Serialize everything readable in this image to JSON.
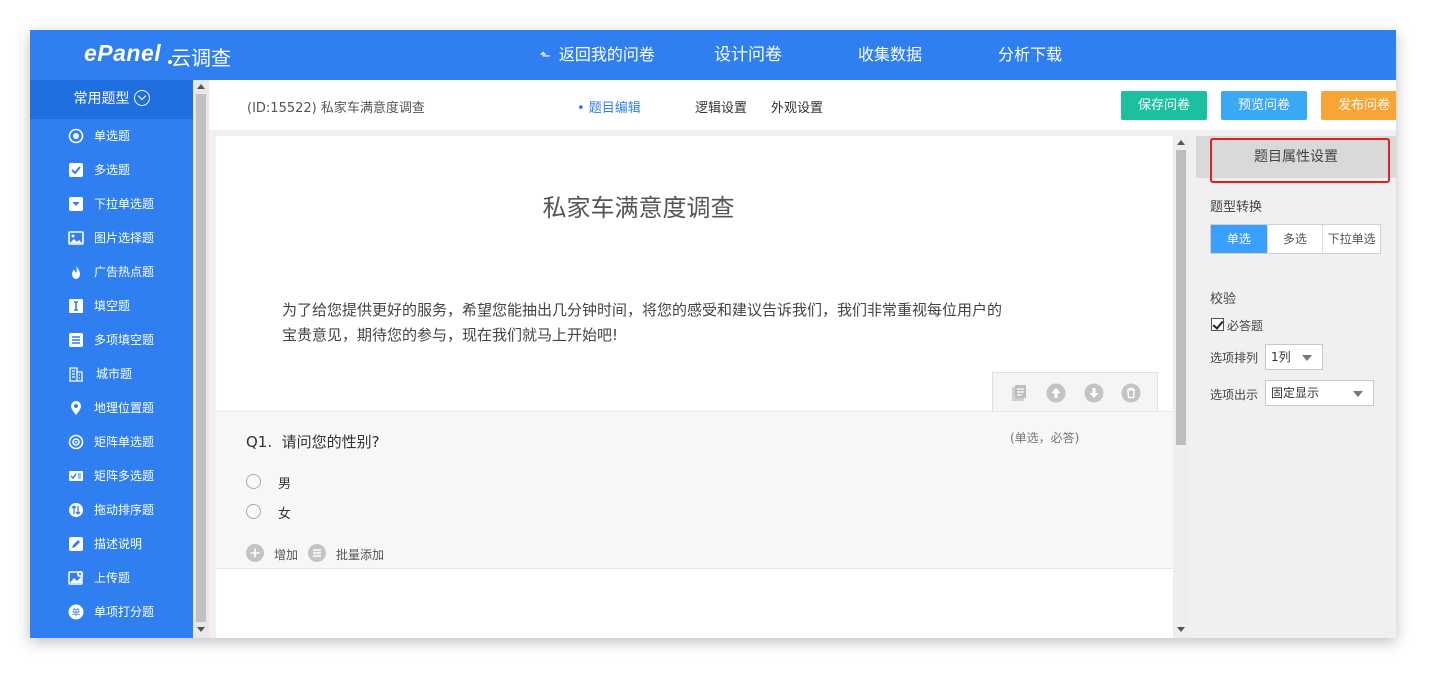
{
  "header": {
    "logo_main": "ePanel",
    "logo_sub": "云调查",
    "nav": [
      {
        "label": "返回我的问卷"
      },
      {
        "label": "设计问卷"
      },
      {
        "label": "收集数据"
      },
      {
        "label": "分析下载"
      }
    ]
  },
  "sidebar": {
    "title": "常用题型",
    "items": [
      {
        "label": "单选题",
        "icon": "radio-icon"
      },
      {
        "label": "多选题",
        "icon": "checkbox-icon"
      },
      {
        "label": "下拉单选题",
        "icon": "dropdown-icon"
      },
      {
        "label": "图片选择题",
        "icon": "image-icon"
      },
      {
        "label": "广告热点题",
        "icon": "flame-icon"
      },
      {
        "label": "填空题",
        "icon": "text-cursor-icon"
      },
      {
        "label": "多项填空题",
        "icon": "list-icon"
      },
      {
        "label": "城市题",
        "icon": "building-icon"
      },
      {
        "label": "地理位置题",
        "icon": "location-pin-icon"
      },
      {
        "label": "矩阵单选题",
        "icon": "target-icon"
      },
      {
        "label": "矩阵多选题",
        "icon": "matrix-check-icon"
      },
      {
        "label": "拖动排序题",
        "icon": "sort-icon"
      },
      {
        "label": "描述说明",
        "icon": "pencil-icon"
      },
      {
        "label": "上传题",
        "icon": "upload-image-icon"
      },
      {
        "label": "单项打分题",
        "icon": "score-icon"
      }
    ]
  },
  "toolbar": {
    "survey_id": "(ID:15522)  私家车满意度调查",
    "tabs": [
      {
        "label": "• 题目编辑"
      },
      {
        "label": "逻辑设置"
      },
      {
        "label": "外观设置"
      }
    ],
    "save_label": "保存问卷",
    "preview_label": "预览问卷",
    "publish_label": "发布问卷"
  },
  "survey": {
    "title": "私家车满意度调查",
    "intro": "为了给您提供更好的服务，希望您能抽出几分钟时间，将您的感受和建议告诉我们，我们非常重视每位用户的宝贵意见，期待您的参与，现在我们就马上开始吧!",
    "question": {
      "number": "Q1.",
      "text": "请问您的性别?",
      "hint": "(单选，必答)",
      "options": [
        {
          "label": "男"
        },
        {
          "label": "女"
        }
      ],
      "add_label": "增加",
      "batch_add_label": "批量添加"
    }
  },
  "panel": {
    "title": "题目属性设置",
    "type_switch_label": "题型转换",
    "type_options": [
      {
        "label": "单选"
      },
      {
        "label": "多选"
      },
      {
        "label": "下拉单选"
      }
    ],
    "validation_label": "校验",
    "required_label": "必答题",
    "arrange_label": "选项排列",
    "arrange_value": "1列",
    "display_label": "选项出示",
    "display_value": "固定显示"
  },
  "colors": {
    "primary": "#2f7ff0",
    "save": "#1cc09f",
    "preview": "#39a8f5",
    "publish": "#f8a535",
    "highlight": "#e02020"
  }
}
